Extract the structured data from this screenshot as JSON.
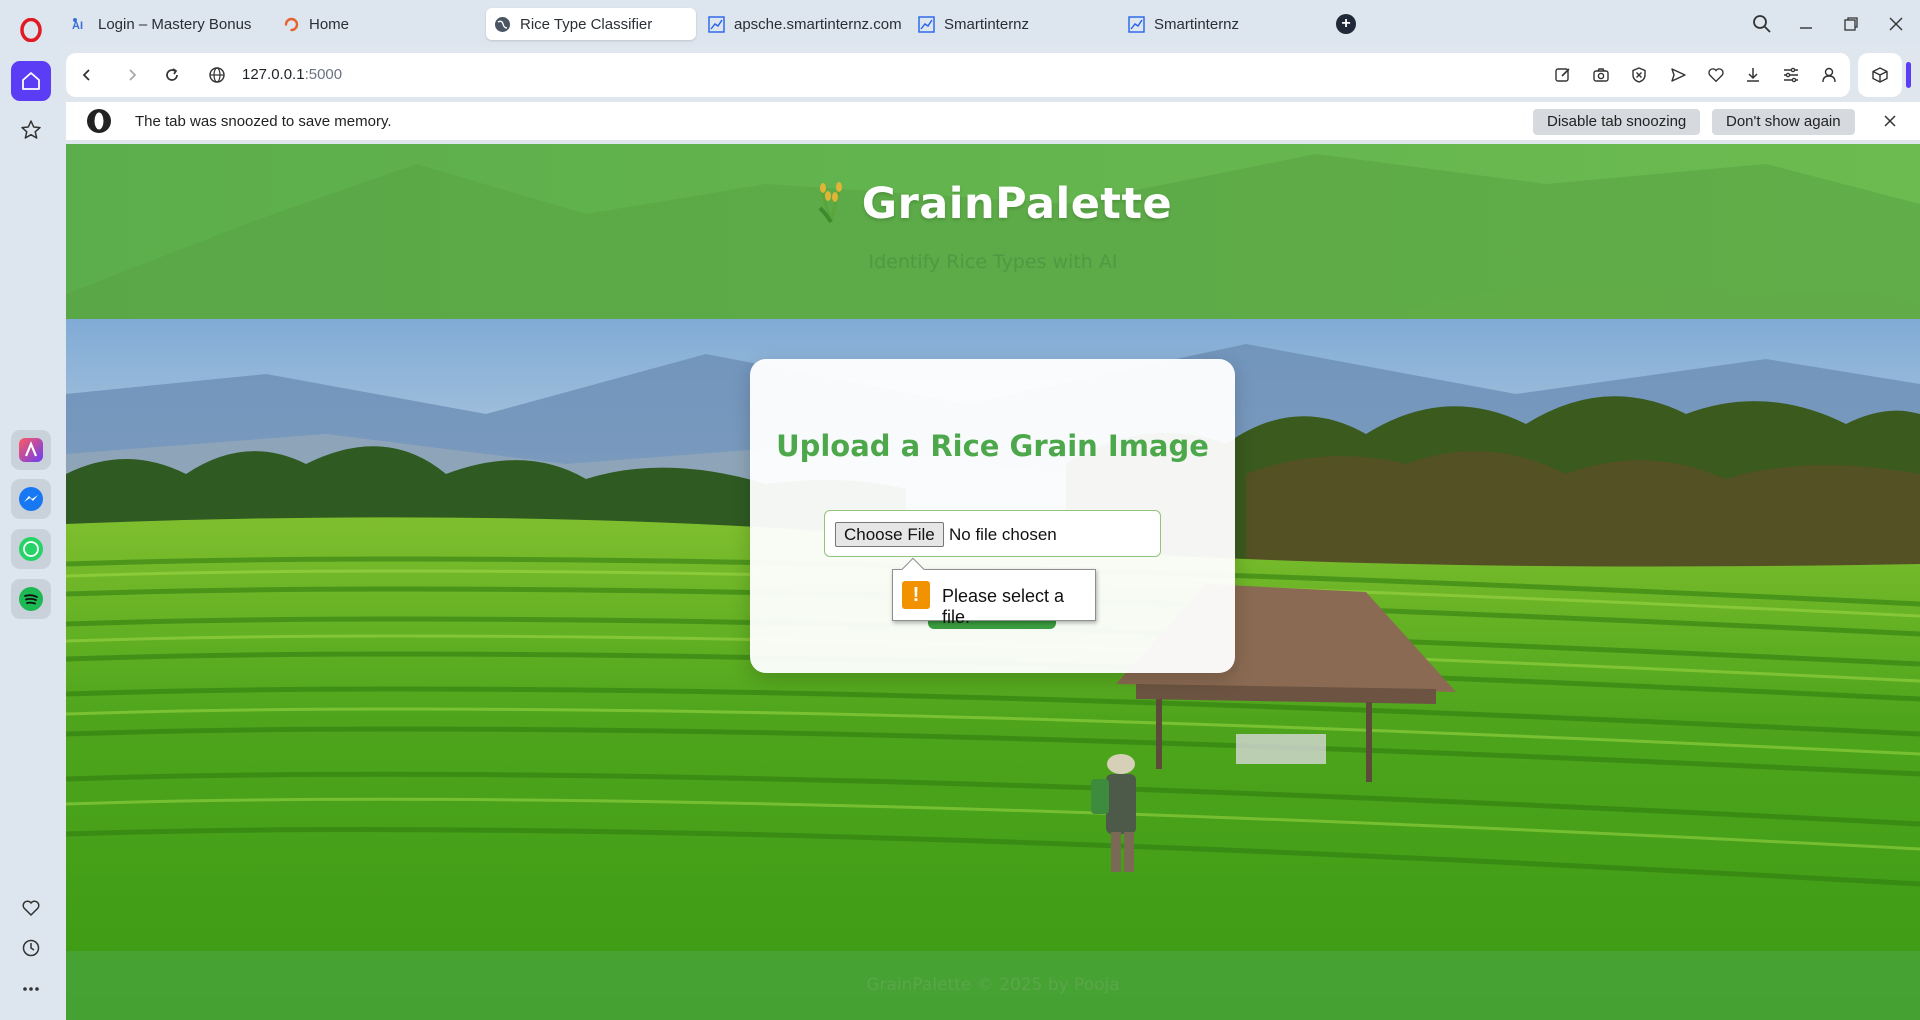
{
  "browser": {
    "tabs": [
      {
        "title": "Login – Mastery Bonus",
        "icon": "ai-icon"
      },
      {
        "title": "Home",
        "icon": "loader-icon"
      },
      {
        "title": "Rice Type Classifier",
        "icon": "globe-icon",
        "active": true
      },
      {
        "title": "apsche.smartinternz.com",
        "icon": "chart-icon"
      },
      {
        "title": "Smartinternz",
        "icon": "chart-icon"
      },
      {
        "title": "Smartinternz",
        "icon": "chart-icon"
      }
    ],
    "url_host": "127.0.0.1",
    "url_port": ":5000",
    "accent_color": "#5b3df5"
  },
  "infobar": {
    "message": "The tab was snoozed to save memory.",
    "disable_label": "Disable tab snoozing",
    "dont_show_label": "Don't show again"
  },
  "page": {
    "brand_title": "GrainPalette",
    "tagline": "Identify Rice Types with AI",
    "card_title": "Upload a Rice Grain Image",
    "choose_file_label": "Choose File",
    "no_file_label": "No file chosen",
    "validation_message": "Please select a file.",
    "footer": "GrainPalette © 2025 by Pooja",
    "primary_color": "#4ca84a"
  }
}
